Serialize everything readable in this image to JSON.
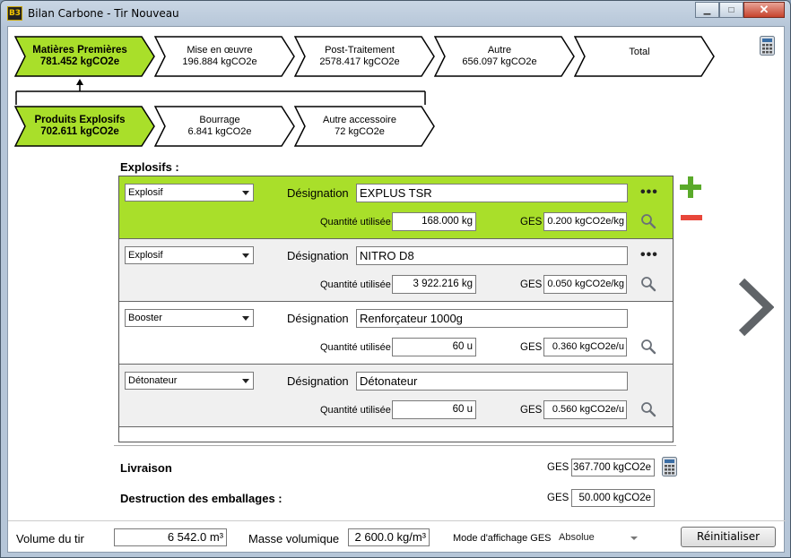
{
  "window": {
    "title": "Bilan Carbone - Tir Nouveau",
    "app_icon_text": "B3"
  },
  "top_steps": [
    {
      "label": "Matières Premières",
      "value": "781.452 kgCO2e",
      "active": true
    },
    {
      "label": "Mise en œuvre",
      "value": "196.884 kgCO2e",
      "active": false
    },
    {
      "label": "Post-Traitement",
      "value": "2578.417 kgCO2e",
      "active": false
    },
    {
      "label": "Autre",
      "value": "656.097 kgCO2e",
      "active": false
    },
    {
      "label": "Total",
      "value": "",
      "active": false
    }
  ],
  "sub_steps": [
    {
      "label": "Produits Explosifs",
      "value": "702.611 kgCO2e",
      "active": true
    },
    {
      "label": "Bourrage",
      "value": "6.841 kgCO2e",
      "active": false
    },
    {
      "label": "Autre accessoire",
      "value": "72 kgCO2e",
      "active": false
    }
  ],
  "explosifs": {
    "title": "Explosifs :",
    "designation_label": "Désignation",
    "quantity_label": "Quantité utilisée",
    "ges_label": "GES",
    "rows": [
      {
        "type": "Explosif",
        "designation": "EXPLUS TSR",
        "quantity": "168.000 kg",
        "ges": "0.200 kgCO2e/kg",
        "has_more": true
      },
      {
        "type": "Explosif",
        "designation": "NITRO D8",
        "quantity": "3 922.216 kg",
        "ges": "0.050 kgCO2e/kg",
        "has_more": true
      },
      {
        "type": "Booster",
        "designation": "Renforçateur 1000g",
        "quantity": "60 u",
        "ges": "0.360 kgCO2e/u",
        "has_more": false
      },
      {
        "type": "Détonateur",
        "designation": "Détonateur",
        "quantity": "60 u",
        "ges": "0.560 kgCO2e/u",
        "has_more": false
      }
    ]
  },
  "livraison": {
    "label": "Livraison",
    "ges_label": "GES",
    "value": "367.700 kgCO2e"
  },
  "destruction": {
    "label": "Destruction des emballages :",
    "ges_label": "GES",
    "value": "50.000 kgCO2e"
  },
  "footer": {
    "volume_label": "Volume du tir",
    "volume_value": "6 542.0 m³",
    "masse_label": "Masse volumique",
    "masse_value": "2 600.0 kg/m³",
    "mode_label": "Mode d'affichage GES",
    "mode_value": "Absolue",
    "reset_label": "Réinitialiser"
  },
  "colors": {
    "active_green": "#a9df2a",
    "plus_green": "#5aaa2a",
    "minus_red": "#e8463a"
  }
}
